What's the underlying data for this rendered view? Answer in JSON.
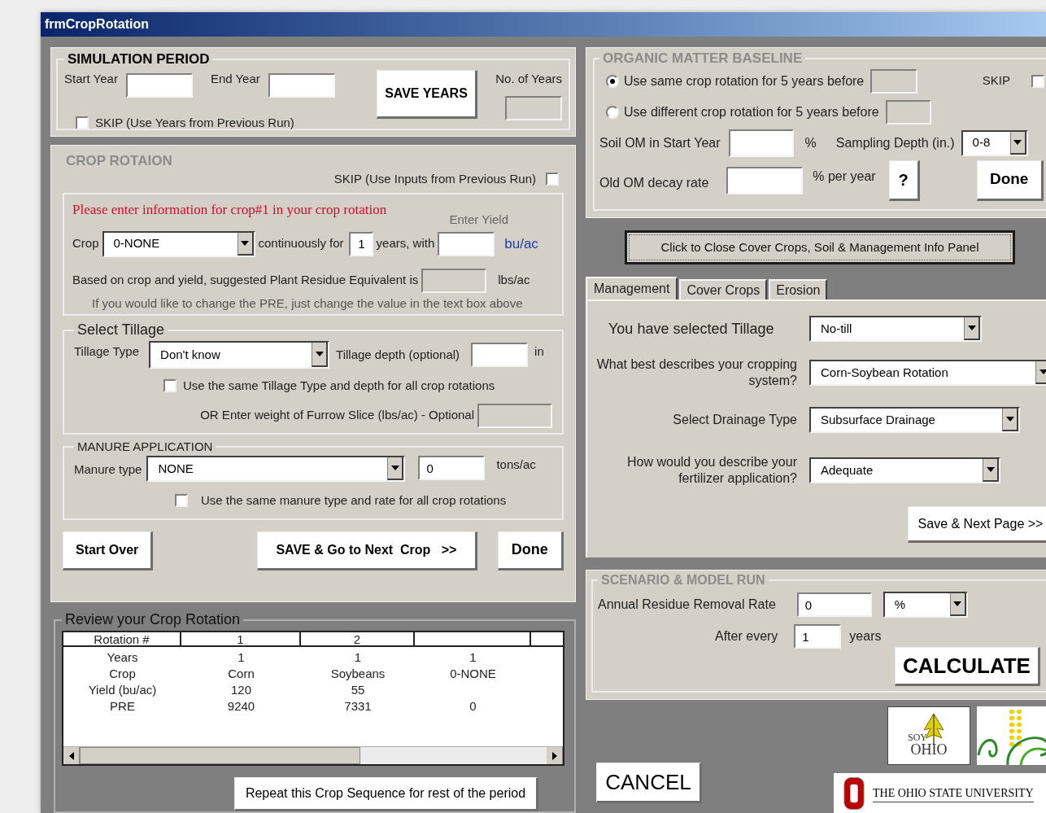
{
  "window": {
    "title": "frmCropRotation"
  },
  "simulation_period": {
    "title": "SIMULATION PERIOD",
    "start_year_label": "Start Year",
    "end_year_label": "End Year",
    "save_button": "SAVE YEARS",
    "years_label": "No. of Years",
    "skip": {
      "label": "SKIP (Use Years from Previous Run)",
      "checked": false
    }
  },
  "crop_rotation": {
    "title": "CROP ROTAION",
    "skip": {
      "label": "SKIP (Use Inputs from Previous Run)",
      "checked": false
    },
    "prompt": "Please enter information for crop#1 in your crop rotation",
    "yield_label": "Enter Yield",
    "crop_label": "Crop",
    "crop_value": "0-NONE",
    "continuously_label": "continuously for",
    "years_value": "1",
    "years_with_label": "years, with",
    "yield_unit": "bu/ac",
    "pre_label": "Based on crop and yield, suggested Plant Residue Equivalent is",
    "pre_unit": "lbs/ac",
    "pre_hint": "If you would like to change the PRE, just change the value in the text box above"
  },
  "tillage": {
    "title": "Select Tillage",
    "type_label": "Tillage Type",
    "type_value": "Don't know",
    "depth_label": "Tillage depth (optional)",
    "depth_unit": "in",
    "same": {
      "label": "Use the same Tillage Type and depth for all crop rotations",
      "checked": false
    },
    "furrow_label": "OR Enter weight of Furrow Slice (lbs/ac) - Optional"
  },
  "manure": {
    "title": "MANURE APPLICATION",
    "type_label": "Manure type",
    "type_value": "NONE",
    "rate_value": "0",
    "rate_unit": "tons/ac",
    "same": {
      "label": "Use the same manure type and rate for all crop rotations",
      "checked": false
    }
  },
  "crop_buttons": {
    "start_over": "Start Over",
    "next_crop": "SAVE & Go to Next  Crop   >>",
    "done": "Done"
  },
  "review": {
    "title": "Review your Crop Rotation",
    "columns": [
      "Rotation #",
      "1",
      "2"
    ],
    "rows": [
      [
        "Years",
        "1",
        "1",
        "1"
      ],
      [
        "Crop",
        "Corn",
        "Soybeans",
        "0-NONE"
      ],
      [
        "Yield (bu/ac)",
        "120",
        "55",
        null
      ],
      [
        "PRE",
        "9240",
        "7331",
        "0"
      ]
    ],
    "repeat_button": "Repeat this Crop Sequence for rest of the period"
  },
  "cancel_button": "CANCEL",
  "organic_matter": {
    "title": "ORGANIC MATTER BASELINE",
    "options": [
      {
        "label": "Use same crop rotation for 5 years before",
        "selected": true
      },
      {
        "label": "Use different crop rotation for 5 years before",
        "selected": false
      }
    ],
    "skip": {
      "label": "SKIP",
      "checked": false
    },
    "soil_om_label": "Soil OM in Start Year",
    "soil_om_unit": "%",
    "depth_label": "Sampling Depth (in.)",
    "depth_value": "0-8",
    "decay_label": "Old OM decay rate",
    "decay_unit": "% per year",
    "help_button": "?",
    "done_button": "Done"
  },
  "panel_toggle_button": "Click to Close Cover Crops, Soil & Management Info Panel",
  "tabs": [
    {
      "label": "Management",
      "selected": true
    },
    {
      "label": "Cover Crops",
      "selected": false
    },
    {
      "label": "Erosion",
      "selected": false
    }
  ],
  "management": {
    "fields": [
      {
        "label": "You have selected Tillage",
        "value": "No-till"
      },
      {
        "label": "What best describes your cropping system?",
        "value": "Corn-Soybean Rotation"
      },
      {
        "label": "Select Drainage Type",
        "value": "Subsurface Drainage"
      },
      {
        "label": "How would you describe your fertilizer application?",
        "value": "Adequate"
      }
    ],
    "next_button": "Save & Next Page >>"
  },
  "scenario": {
    "title": "SCENARIO & MODEL RUN",
    "removal_label": "Annual Residue Removal Rate",
    "removal_value": "0",
    "removal_unit": "%",
    "after_label": "After every",
    "after_value": "1",
    "after_unit": "years",
    "calculate_button": "CALCULATE"
  },
  "logos": {
    "soy_words": [
      "SOY",
      "OHIO"
    ],
    "university": "THE OHIO STATE UNIVERSITY"
  }
}
